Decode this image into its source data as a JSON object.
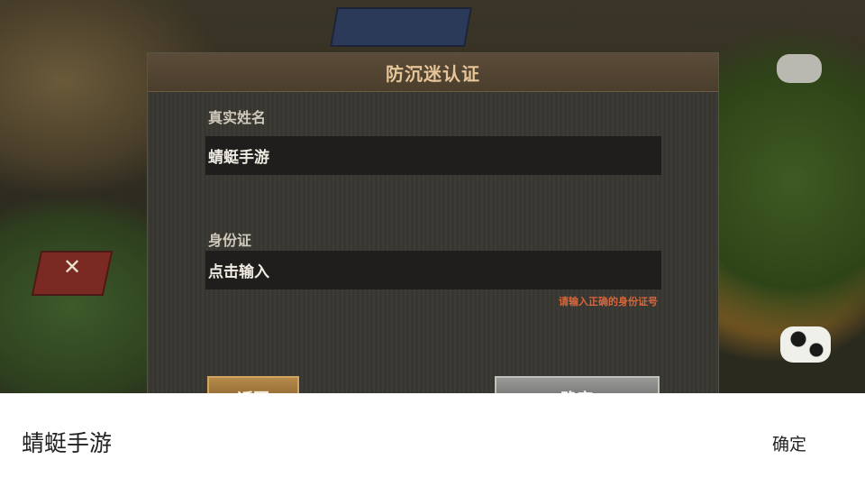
{
  "dialog": {
    "title": "防沉迷认证",
    "name_label": "真实姓名",
    "name_value": "蜻蜓手游",
    "id_label": "身份证",
    "id_placeholder": "点击输入",
    "error_hint": "请输入正确的身份证号",
    "back_label": "返回",
    "confirm_label": "确定"
  },
  "ime": {
    "input_text": "蜻蜓手游",
    "ok_label": "确定"
  },
  "colors": {
    "title": "#e6c598",
    "error": "#d9663a",
    "back_button": "#a87a3c",
    "confirm_button": "#8a8a88"
  }
}
